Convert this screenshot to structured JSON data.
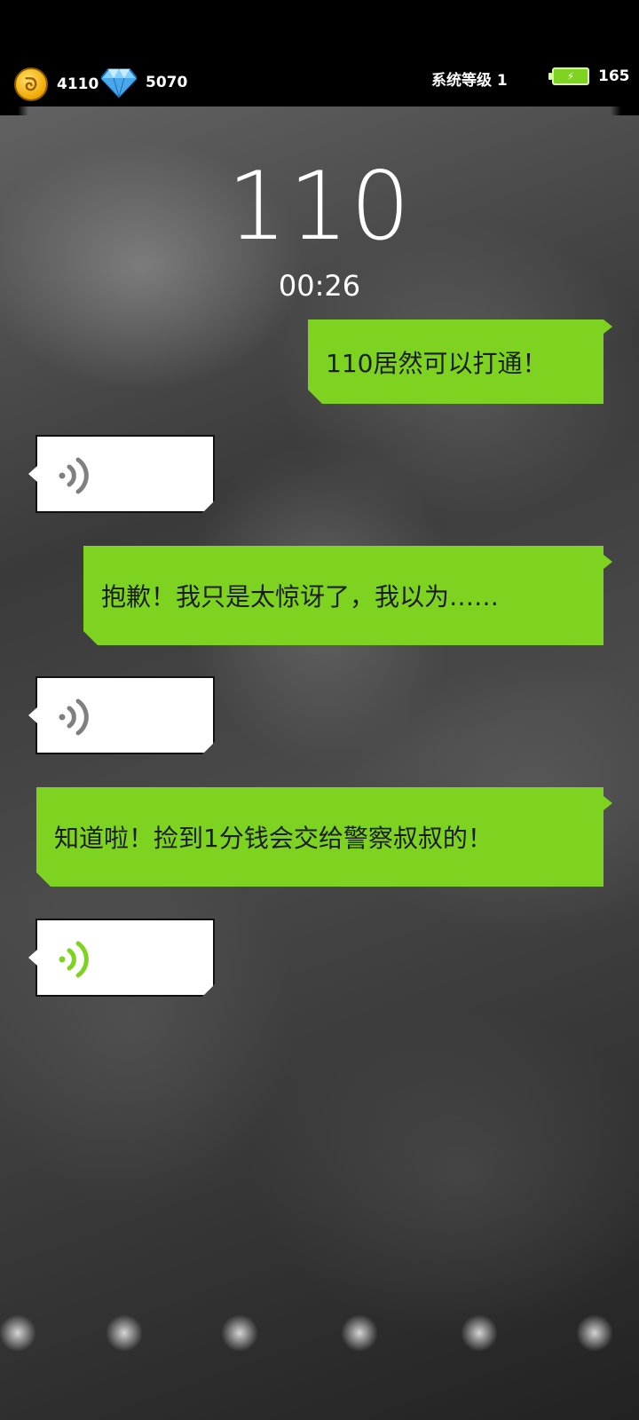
{
  "status": {
    "coins": "4110",
    "diamonds": "5070",
    "system_level": "系统等级 1",
    "energy": "165"
  },
  "call": {
    "number": "110",
    "duration": "00:26"
  },
  "messages": [
    {
      "side": "right",
      "type": "text",
      "text": "110居然可以打通！"
    },
    {
      "side": "left",
      "type": "voice",
      "state": "idle",
      "icon": "voice-wave-icon"
    },
    {
      "side": "right",
      "type": "text",
      "text": "抱歉！我只是太惊讶了，我以为……"
    },
    {
      "side": "left",
      "type": "voice",
      "state": "idle",
      "icon": "voice-wave-icon"
    },
    {
      "side": "right",
      "type": "text",
      "text": "知道啦！捡到1分钱会交给警察叔叔的！"
    },
    {
      "side": "left",
      "type": "voice",
      "state": "playing",
      "icon": "voice-wave-icon"
    }
  ],
  "colors": {
    "accent_green": "#7ed321",
    "voice_idle": "#808080",
    "voice_active": "#7ed321"
  }
}
